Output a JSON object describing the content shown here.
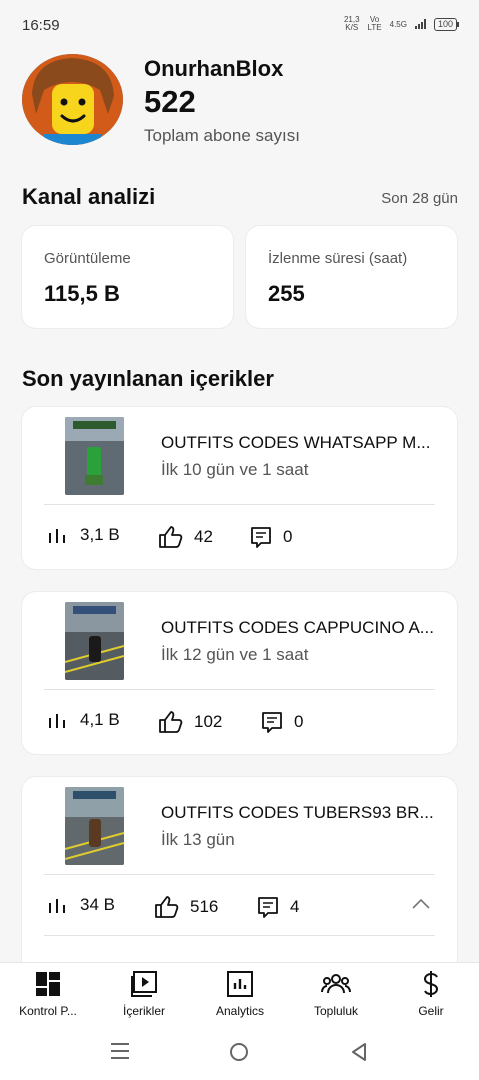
{
  "status_bar": {
    "time": "16:59",
    "speed": "21,3",
    "speed_unit": "K/S",
    "vo": "Vo",
    "lte": "LTE",
    "network": "4.5G",
    "battery": "100"
  },
  "channel": {
    "name": "OnurhanBlox",
    "subscribers": "522",
    "subscribers_label": "Toplam abone sayısı"
  },
  "analytics": {
    "title": "Kanal analizi",
    "period": "Son 28 gün",
    "stats": [
      {
        "label": "Görüntüleme",
        "value": "115,5 B"
      },
      {
        "label": "İzlenme süresi (saat)",
        "value": "255"
      }
    ]
  },
  "recent": {
    "title": "Son yayınlanan içerikler",
    "videos": [
      {
        "title": "OUTFITS CODES WHATSAPP M...",
        "age": "İlk 10 gün ve 1 saat",
        "views": "3,1 B",
        "likes": "42",
        "comments": "0"
      },
      {
        "title": "OUTFITS CODES CAPPUCINO A...",
        "age": "İlk 12 gün ve 1 saat",
        "views": "4,1 B",
        "likes": "102",
        "comments": "0"
      },
      {
        "title": "OUTFITS CODES TUBERS93 BR...",
        "age": "İlk 13 gün",
        "views": "34 B",
        "likes": "516",
        "comments": "4"
      }
    ]
  },
  "bottom_nav": [
    {
      "label": "Kontrol P...",
      "icon": "dashboard-icon"
    },
    {
      "label": "İçerikler",
      "icon": "content-icon"
    },
    {
      "label": "Analytics",
      "icon": "analytics-icon"
    },
    {
      "label": "Topluluk",
      "icon": "community-icon"
    },
    {
      "label": "Gelir",
      "icon": "earn-icon"
    }
  ],
  "colors": {
    "background": "#f6f6f6",
    "card": "#ffffff",
    "text": "#0f0f0f",
    "secondary_text": "#555555"
  }
}
